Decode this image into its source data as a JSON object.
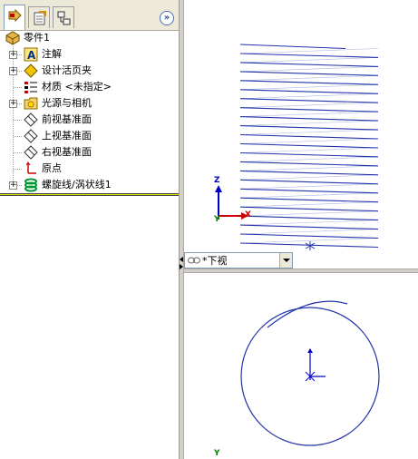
{
  "tree": {
    "part_name": "零件1",
    "items": [
      {
        "label": "注解",
        "icon": "annotation-icon",
        "expandable": true
      },
      {
        "label": "设计活页夹",
        "icon": "design-binder-icon",
        "expandable": true
      },
      {
        "label": "材质 <未指定>",
        "icon": "material-icon",
        "expandable": false
      },
      {
        "label": "光源与相机",
        "icon": "lights-cameras-icon",
        "expandable": true
      },
      {
        "label": "前视基准面",
        "icon": "plane-icon",
        "expandable": false
      },
      {
        "label": "上视基准面",
        "icon": "plane-icon",
        "expandable": false
      },
      {
        "label": "右视基准面",
        "icon": "plane-icon",
        "expandable": false
      },
      {
        "label": "原点",
        "icon": "origin-icon",
        "expandable": false
      },
      {
        "label": "螺旋线/涡状线1",
        "icon": "helix-icon",
        "expandable": true
      }
    ]
  },
  "tabs": [
    {
      "name": "feature-manager",
      "active": true
    },
    {
      "name": "property-manager",
      "active": false
    },
    {
      "name": "configuration-manager",
      "active": false
    }
  ],
  "viewport": {
    "view_select_value": "*下视",
    "triad_top": {
      "z": "Z",
      "x": "X",
      "y": "Y"
    },
    "triad_bottom": {
      "y": "Y"
    }
  },
  "colors": {
    "helix": "#2233aa",
    "axis_x": "#cc0000",
    "axis_z": "#0000cc",
    "axis_y": "#008800"
  }
}
